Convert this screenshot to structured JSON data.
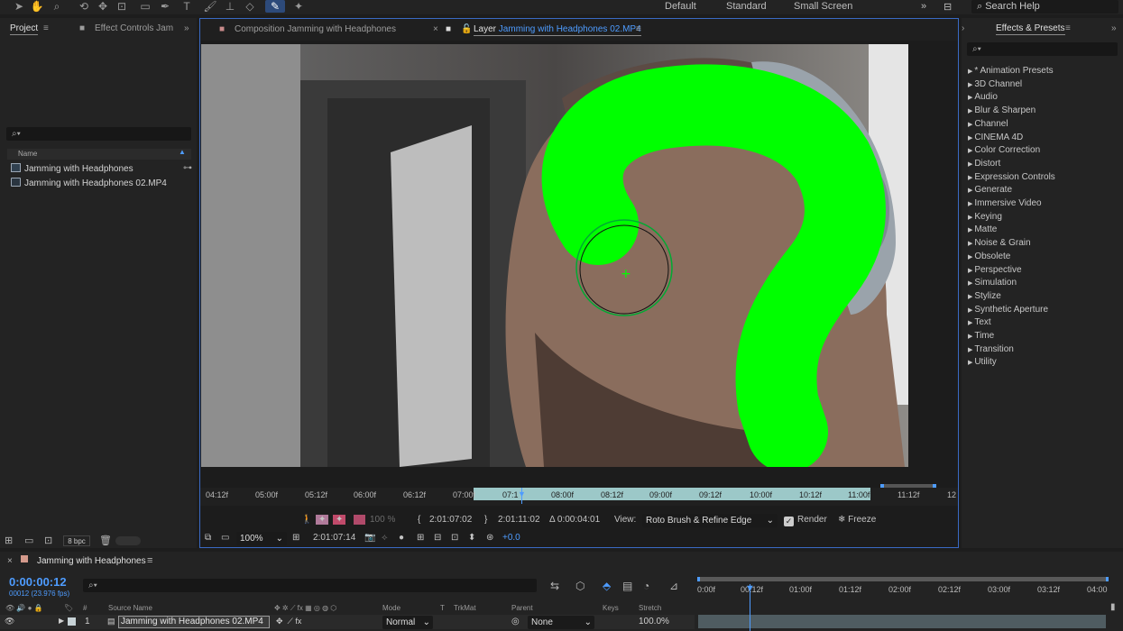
{
  "workspaces": {
    "default": "Default",
    "standard": "Standard",
    "small_screen": "Small Screen",
    "search_help": "Search Help"
  },
  "project_panel": {
    "tab_project": "Project",
    "tab_effect_controls": "Effect Controls Jam",
    "name_header": "Name",
    "items": [
      {
        "label": "Jamming with Headphones",
        "icon": "composition-icon"
      },
      {
        "label": "Jamming with Headphones 02.MP4",
        "icon": "footage-file-icon"
      }
    ],
    "bpc": "8 bpc"
  },
  "viewer": {
    "tab_composition": "Composition Jamming with Headphones",
    "tab_layer_prefix": "Layer",
    "tab_layer_name": "Jamming with Headphones 02.MP4",
    "ruler_labels": [
      "04:12f",
      "05:00f",
      "05:12f",
      "06:00f",
      "06:12f",
      "07:00f",
      "07:1",
      "08:00f",
      "08:12f",
      "09:00f",
      "09:12f",
      "10:00f",
      "10:12f",
      "11:00f",
      "11:12f",
      "12"
    ],
    "opacity": "100 %",
    "in_point": "2:01:07:02",
    "out_point": "2:01:11:02",
    "duration": "Δ 0:00:04:01",
    "view_label": "View:",
    "view_value": "Roto Brush & Refine Edge",
    "render_label": "Render",
    "freeze_label": "Freeze",
    "zoom": "100%",
    "current_time": "2:01:07:14",
    "exposure": "+0.0",
    "roto_color": "#00ff00"
  },
  "effects_panel": {
    "title": "Effects & Presets",
    "items": [
      "* Animation Presets",
      "3D Channel",
      "Audio",
      "Blur & Sharpen",
      "Channel",
      "CINEMA 4D",
      "Color Correction",
      "Distort",
      "Expression Controls",
      "Generate",
      "Immersive Video",
      "Keying",
      "Matte",
      "Noise & Grain",
      "Obsolete",
      "Perspective",
      "Simulation",
      "Stylize",
      "Synthetic Aperture",
      "Text",
      "Time",
      "Transition",
      "Utility"
    ]
  },
  "timeline": {
    "comp_name": "Jamming with Headphones",
    "timecode": "0:00:00:12",
    "fps": "00012 (23.976 fps)",
    "headers": {
      "num": "#",
      "source_name": "Source Name",
      "mode": "Mode",
      "t": "T",
      "trkmat": "TrkMat",
      "parent": "Parent",
      "keys": "Keys",
      "stretch": "Stretch"
    },
    "layer": {
      "index": "1",
      "name": "Jamming with Headphones 02.MP4",
      "mode": "Normal",
      "parent": "None",
      "stretch": "100.0%"
    },
    "ruler_labels": [
      "0:00f",
      "00:12f",
      "01:00f",
      "01:12f",
      "02:00f",
      "02:12f",
      "03:00f",
      "03:12f",
      "04:00"
    ]
  }
}
